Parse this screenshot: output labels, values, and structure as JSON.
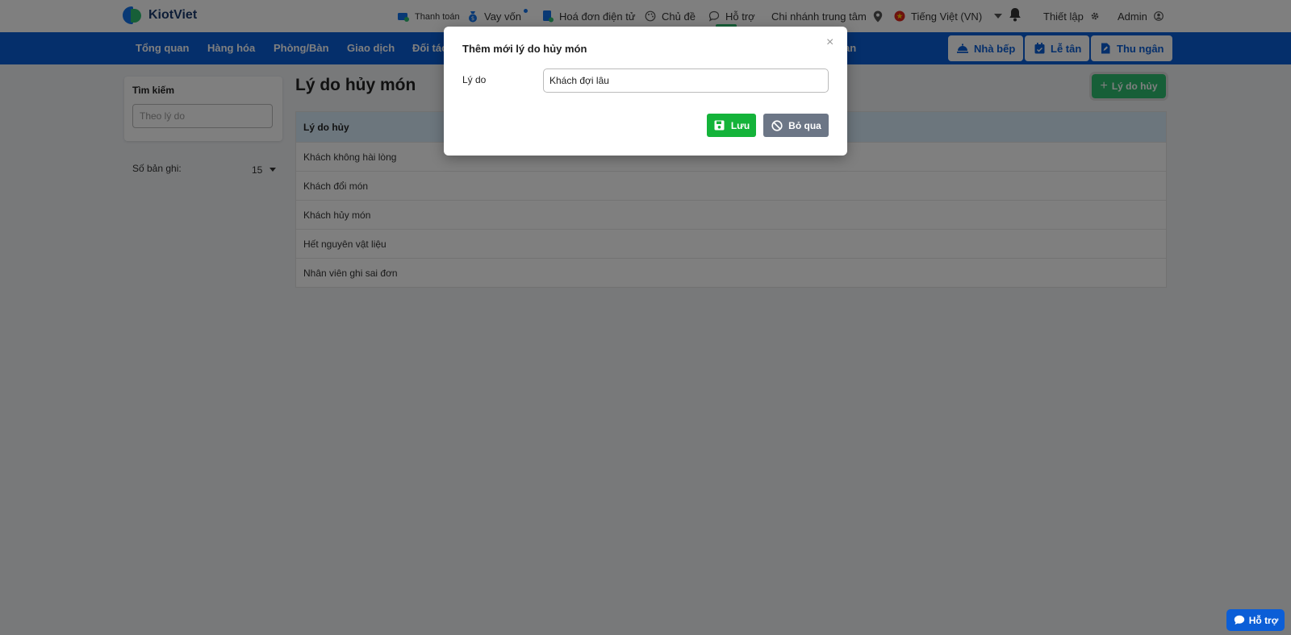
{
  "brand": {
    "name": "KiotViet",
    "colors": {
      "primary": "#0b5ed7",
      "accent": "#2fbf71",
      "save": "#14b33a",
      "skip": "#6c7686"
    }
  },
  "topnav": {
    "payment": "Thanh toán",
    "loan": "Vay vốn",
    "einvoice": "Hoá đơn điện tử",
    "theme": "Chủ đề",
    "support": "Hỗ trợ",
    "branch": "Chi nhánh trung tâm",
    "language": "Tiếng Việt (VN)",
    "settings": "Thiết lập",
    "user": "Admin"
  },
  "mainnav": {
    "items": [
      "Tổng quan",
      "Hàng hóa",
      "Phòng/Bàn",
      "Giao dịch",
      "Đối tác",
      "an"
    ],
    "kitchen": "Nhà bếp",
    "reception": "Lễ tân",
    "cashier": "Thu ngân"
  },
  "sidebar": {
    "search_title": "Tìm kiếm",
    "search_placeholder": "Theo lý do",
    "records_label": "Số bản ghi:",
    "records_value": "15"
  },
  "main": {
    "title": "Lý do hủy món",
    "add_button": "Lý do hủy",
    "column_header": "Lý do hủy",
    "rows": [
      "Khách không hài lòng",
      "Khách đổi món",
      "Khách hủy món",
      "Hết nguyên vật liệu",
      "Nhân viên ghi sai đơn"
    ]
  },
  "modal": {
    "title": "Thêm mới lý do hủy món",
    "close": "×",
    "field_label": "Lý do",
    "field_value": "Khách đợi lâu",
    "save": "Lưu",
    "skip": "Bỏ qua"
  },
  "float_help": "Hỗ trợ"
}
